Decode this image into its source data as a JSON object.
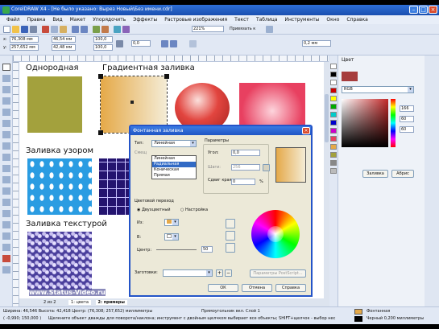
{
  "titlebar": {
    "title": "CorelDRAW X4 - [Не было указано: Вырез Новый\\Без имени.cdr]"
  },
  "menu": [
    "Файл",
    "Правка",
    "Вид",
    "Макет",
    "Упорядочить",
    "Эффекты",
    "Растровые изображения",
    "Текст",
    "Таблица",
    "Инструменты",
    "Окно",
    "Справка"
  ],
  "toolbar": {
    "zoom": "221%",
    "snap": "Привязать к",
    "outline": "0,2 мм"
  },
  "propbar": {
    "x": "76,308 мм",
    "y": "257,652 мм",
    "w": "46,54 мм",
    "h": "42,48 мм",
    "sx": "100,0",
    "sy": "100,0",
    "angle": "0,0"
  },
  "canvas": {
    "label_uniform": "Однородная",
    "label_gradient": "Градиентная заливка",
    "label_pattern": "Заливка узором",
    "label_texture": "Заливка текстурой",
    "watermark": "www.Status-Video.ru"
  },
  "colors": {
    "olive": "#a3a13d",
    "gradient_start": "#e5a948",
    "gradient_end": "#f4ecd6",
    "sphere": "#e2453f",
    "pink": "#e84060",
    "blue_pattern": "#2a9ce2",
    "navy_pattern": "#24146f",
    "texture": "#4a3e9c",
    "accent": "#2f6fd6"
  },
  "dialog": {
    "title": "Фонтанная заливка",
    "type_label": "Тип:",
    "type_value": "Линейная",
    "type_options": [
      "Линейная",
      "Радиальная",
      "Коническая",
      "Прямая"
    ],
    "center_label": "Смещ",
    "params_label": "Параметры",
    "angle_label": "Угол:",
    "angle_value": "0,0",
    "steps_label": "Шаги:",
    "steps_value": "256",
    "edge_label": "Сдвиг края:",
    "edge_value": "0",
    "edge_unit": "%",
    "blend_label": "Цветовой переход",
    "two_color": "Двухцветный",
    "custom": "Настройка",
    "from_label": "Из:",
    "to_label": "В:",
    "mid_label": "Центр:",
    "mid_value": "50",
    "presets_label": "Заготовки:",
    "pscontrol": "Параметры PostScript...",
    "ok": "ОК",
    "cancel": "Отмена",
    "help": "Справка"
  },
  "docker": {
    "title": "Цвет",
    "model": "RGB",
    "values": [
      "166",
      "60",
      "60"
    ],
    "fill": "Заливка",
    "outline": "Абрис"
  },
  "pages": {
    "current": "2 из 2",
    "page1": "1: цвета",
    "page2": "2: примеры"
  },
  "status": {
    "dims": "Ширина: 46,546 Высота: 42,418 Центр: (76,308; 257,652) миллиметры",
    "object": "Прямоугольник вкл. Слой 1",
    "hint": "Щелкните объект дважды для поворота/наклона; инструмент с двойным щелчком выбирает все объекты; SHIFT+щелчок - выбор нес",
    "coords": "( -0,990; 150,000 )",
    "fill_status": "Фонтанная",
    "outline_status": "Черный  0,200 миллиметры"
  }
}
